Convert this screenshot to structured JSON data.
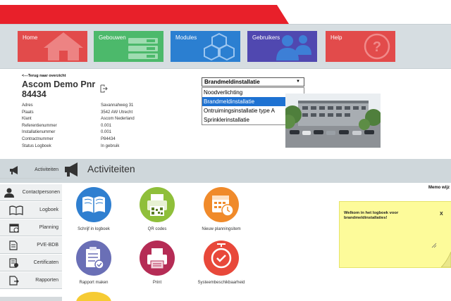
{
  "nav": {
    "tiles": [
      {
        "label": "Home",
        "color": "#e24b4b",
        "icon": "house-icon"
      },
      {
        "label": "Gebouwen",
        "color": "#4cb96b",
        "icon": "building-list-icon"
      },
      {
        "label": "Modules",
        "color": "#2b7fd1",
        "icon": "cubes-icon"
      },
      {
        "label": "Gebruikers",
        "color": "#5048b0",
        "icon": "users-icon"
      },
      {
        "label": "Help",
        "color": "#e24b4b",
        "icon": "question-icon"
      }
    ]
  },
  "back_link": "<---Terug naar overzicht",
  "project_title": "Ascom Demo Pnr 84434",
  "info_rows": [
    {
      "label": "Adres",
      "value": "Savannahweg 31"
    },
    {
      "label": "Plaats",
      "value": "3542 AW Utrecht"
    },
    {
      "label": "Klant",
      "value": "Ascom Nederland"
    },
    {
      "label": "Referentienummer",
      "value": "0.001"
    },
    {
      "label": "Installatienummer",
      "value": "0.001"
    },
    {
      "label": "Contractnummer",
      "value": "P84434"
    },
    {
      "label": "Status Logboek",
      "value": "In gebruik"
    }
  ],
  "installation_select": {
    "selected": "Brandmeldinstallatie",
    "options": [
      "Noodverlichting",
      "Brandmeldinstallatie",
      "Ontruimingsinstallatie type A",
      "Sprinklerinstallatie"
    ],
    "highlighted_index": 1
  },
  "section": {
    "title": "Activiteiten"
  },
  "sidebar": {
    "items": [
      {
        "label": "Activiteiten",
        "icon": "megaphone-icon",
        "active": true
      },
      {
        "label": "Contactpersonen",
        "icon": "contact-person-icon",
        "active": false
      },
      {
        "label": "Logboek",
        "icon": "book-icon",
        "active": false
      },
      {
        "label": "Planning",
        "icon": "calendar-icon",
        "active": false
      },
      {
        "label": "PVE-BDB",
        "icon": "document-icon",
        "active": false
      },
      {
        "label": "Certificaten",
        "icon": "certificate-icon",
        "active": false
      },
      {
        "label": "Rapporten",
        "icon": "report-icon",
        "active": false
      }
    ]
  },
  "actions": [
    {
      "label": "Schrijf in logboek",
      "color": "#2f7fd0",
      "icon": "open-book-icon"
    },
    {
      "label": "QR codes",
      "color": "#8fbf3a",
      "icon": "qr-printer-icon"
    },
    {
      "label": "Nieuw planningsitem",
      "color": "#f08a2a",
      "icon": "calendar-clock-icon"
    },
    {
      "label": "Rapport maken",
      "color": "#6a6fb6",
      "icon": "report-check-icon"
    },
    {
      "label": "Print",
      "color": "#b52c55",
      "icon": "printer-icon"
    },
    {
      "label": "Systeembeschikbaarheid",
      "color": "#e8483a",
      "icon": "clock-check-icon"
    }
  ],
  "memo": {
    "title": "Memo wijz",
    "text": "Welkom in het logboek voor brandmeldinstallaties!",
    "close_label": "X"
  },
  "colors": {
    "brand_red": "#e8202a",
    "nav_band": "#d6dde1",
    "memo_bg": "#fdfb9a",
    "selection_blue": "#1e72d2"
  }
}
